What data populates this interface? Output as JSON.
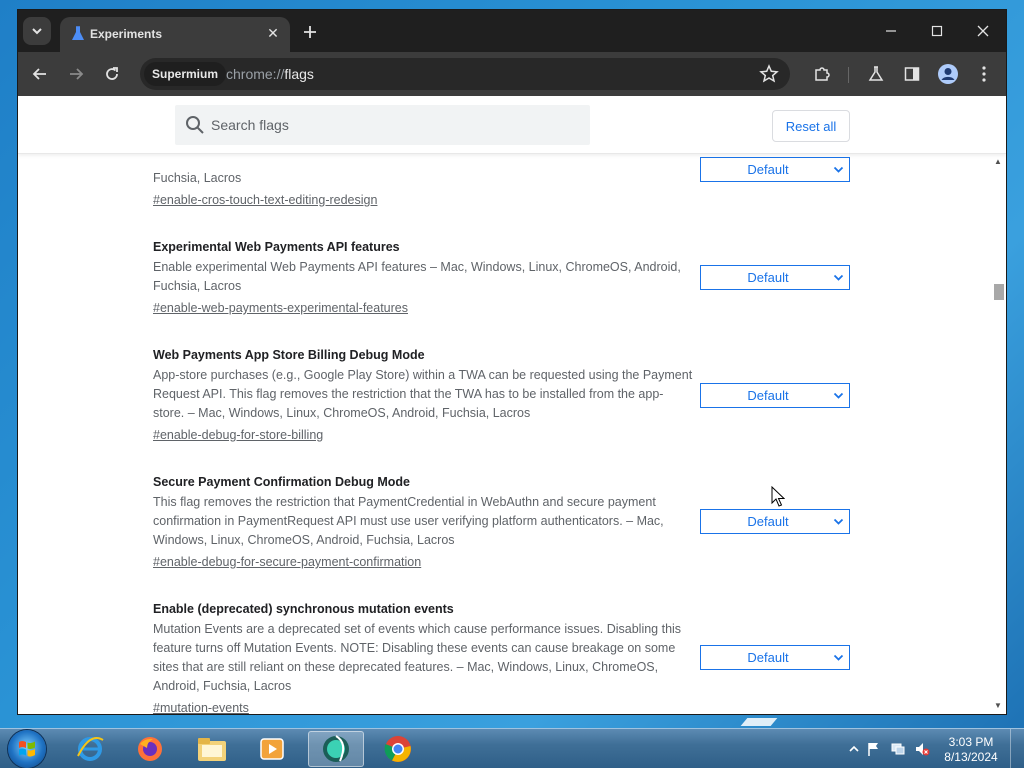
{
  "browser": {
    "tab_title": "Experiments",
    "chip_label": "Supermium",
    "url_scheme": "chrome://",
    "url_path": "flags"
  },
  "flags_page": {
    "search_placeholder": "Search flags",
    "reset_label": "Reset all",
    "flags": [
      {
        "title": "",
        "description": "Fuchsia, Lacros",
        "link": "#enable-cros-touch-text-editing-redesign",
        "value": "Default"
      },
      {
        "title": "Experimental Web Payments API features",
        "description": "Enable experimental Web Payments API features – Mac, Windows, Linux, ChromeOS, Android, Fuchsia, Lacros",
        "link": "#enable-web-payments-experimental-features",
        "value": "Default"
      },
      {
        "title": "Web Payments App Store Billing Debug Mode",
        "description": "App-store purchases (e.g., Google Play Store) within a TWA can be requested using the Payment Request API. This flag removes the restriction that the TWA has to be installed from the app-store. – Mac, Windows, Linux, ChromeOS, Android, Fuchsia, Lacros",
        "link": "#enable-debug-for-store-billing",
        "value": "Default"
      },
      {
        "title": "Secure Payment Confirmation Debug Mode",
        "description": "This flag removes the restriction that PaymentCredential in WebAuthn and secure payment confirmation in PaymentRequest API must use user verifying platform authenticators. – Mac, Windows, Linux, ChromeOS, Android, Fuchsia, Lacros",
        "link": "#enable-debug-for-secure-payment-confirmation",
        "value": "Default"
      },
      {
        "title": "Enable (deprecated) synchronous mutation events",
        "description": "Mutation Events are a deprecated set of events which cause performance issues. Disabling this feature turns off Mutation Events. NOTE: Disabling these events can cause breakage on some sites that are still reliant on these deprecated features. – Mac, Windows, Linux, ChromeOS, Android, Fuchsia, Lacros",
        "link": "#mutation-events",
        "value": "Default"
      }
    ]
  },
  "taskbar": {
    "time": "3:03 PM",
    "date": "8/13/2024"
  },
  "icons": {
    "tab_favicon": "flask-icon",
    "back": "back-arrow-icon",
    "forward": "forward-arrow-icon",
    "reload": "reload-icon",
    "bookmark": "star-icon",
    "extensions": "puzzle-icon",
    "labs": "flask-icon",
    "side_panel": "side-panel-icon",
    "profile": "avatar-icon",
    "menu": "kebab-menu-icon"
  },
  "colors": {
    "accent": "#1a73e8",
    "tabbar": "#1f1f1f",
    "toolbar": "#3c3c3c"
  }
}
